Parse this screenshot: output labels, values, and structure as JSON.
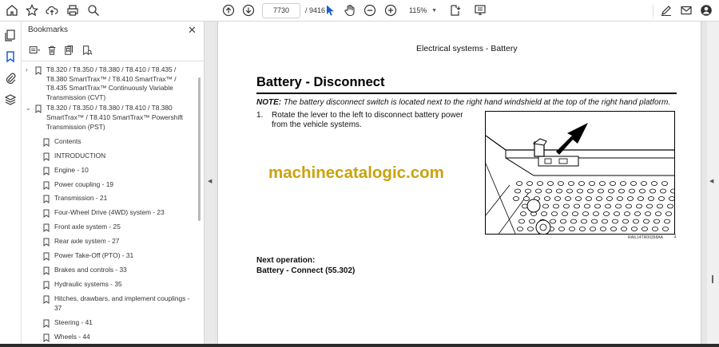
{
  "toolbar": {
    "current_page": "7730",
    "total_pages": "/ 9416",
    "zoom": "115%"
  },
  "bookmarks": {
    "title": "Bookmarks",
    "items": [
      {
        "label": "T8.320 / T8.350 / T8.380 / T8.410 / T8.435 / T8.380 SmartTrax™ / T8.410 SmartTrax™ / T8.435 SmartTrax™ Continuously Variable Transmission (CVT)",
        "level": 0,
        "expand": "collapsed"
      },
      {
        "label": "T8.320 / T8.350 / T8.380 / T8.410 / T8.380 SmartTrax™ / T8.410 SmartTrax™ Powershift Transmission (PST)",
        "level": 0,
        "expand": "expanded"
      },
      {
        "label": "Contents",
        "level": 1
      },
      {
        "label": "INTRODUCTION",
        "level": 1
      },
      {
        "label": "Engine - 10",
        "level": 1
      },
      {
        "label": "Power coupling - 19",
        "level": 1
      },
      {
        "label": "Transmission - 21",
        "level": 1
      },
      {
        "label": "Four-Wheel Drive (4WD) system - 23",
        "level": 1
      },
      {
        "label": "Front axle system - 25",
        "level": 1
      },
      {
        "label": "Rear axle system - 27",
        "level": 1
      },
      {
        "label": "Power Take-Off (PTO) - 31",
        "level": 1
      },
      {
        "label": "Brakes and controls - 33",
        "level": 1
      },
      {
        "label": "Hydraulic systems - 35",
        "level": 1
      },
      {
        "label": "Hitches, drawbars, and implement couplings - 37",
        "level": 1
      },
      {
        "label": "Steering - 41",
        "level": 1
      },
      {
        "label": "Wheels - 44",
        "level": 1
      }
    ]
  },
  "document": {
    "header": "Electrical systems - Battery",
    "title": "Battery - Disconnect",
    "note_label": "NOTE:",
    "note_text": " The battery disconnect switch is located next to the right hand windshield at the top of the right hand platform.",
    "step_number": "1.",
    "step_text": "Rotate the lever to the left to disconnect battery power from the vehicle systems.",
    "watermark": "machinecatalogic.com",
    "figure_caption": "RAIL14TR00358AA",
    "figure_number": "1",
    "next_label": "Next operation:",
    "next_link": "Battery - Connect (55.302)"
  },
  "colors": {
    "watermark": "#caa20c",
    "accent_blue": "#1a5fd0"
  }
}
